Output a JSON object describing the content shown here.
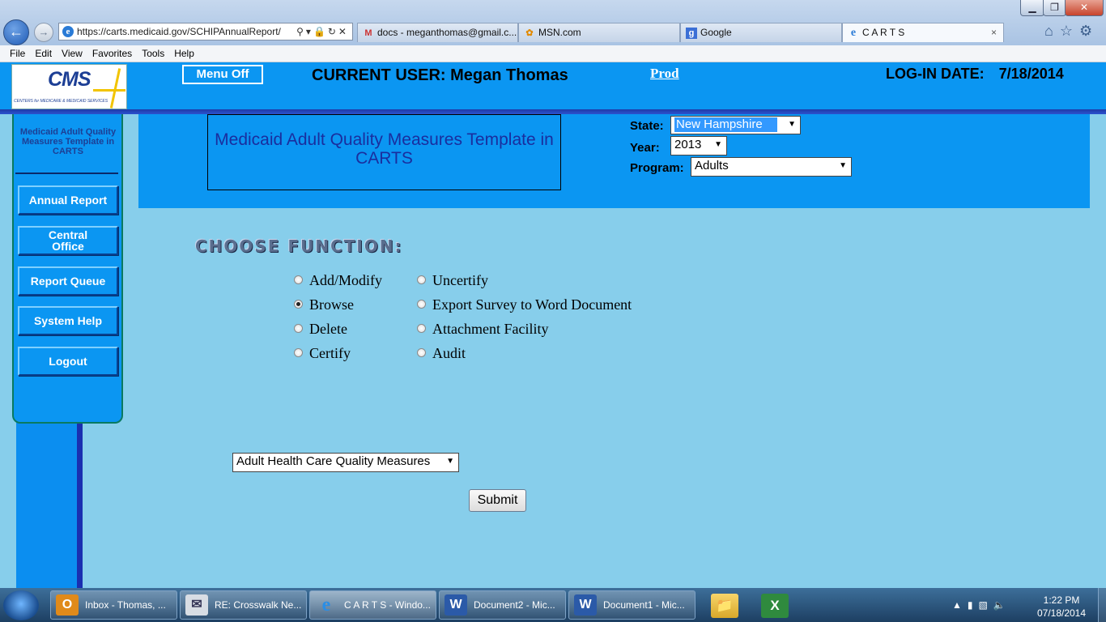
{
  "browser": {
    "url": "https://carts.medicaid.gov/SCHIPAnnualReport/",
    "tabs": [
      {
        "label": "docs - meganthomas@gmail.c..."
      },
      {
        "label": "MSN.com"
      },
      {
        "label": "Google"
      },
      {
        "label": "C A R T S"
      }
    ],
    "tab_close": "×",
    "menu": [
      "File",
      "Edit",
      "View",
      "Favorites",
      "Tools",
      "Help"
    ],
    "window_buttons": {
      "minimize": "▁",
      "maximize": "❐",
      "close": "✕"
    },
    "icons": [
      "home-icon",
      "favorites-star-icon",
      "tools-gear-icon"
    ]
  },
  "header": {
    "logo_text": "CMS",
    "logo_subtext": "CENTERS for MEDICARE & MEDICAID SERVICES",
    "menu_off": "Menu Off",
    "current_user": "CURRENT USER: Megan Thomas",
    "environment": "Prod",
    "login_date_label": "LOG-IN DATE:",
    "login_date": "7/18/2014"
  },
  "left_nav": {
    "title": "Medicaid Adult Quality Measures Template in CARTS",
    "items": [
      {
        "label": "Annual Report"
      },
      {
        "label": "Central Office"
      },
      {
        "label": "Report Queue"
      },
      {
        "label": "System Help"
      },
      {
        "label": "Logout"
      }
    ]
  },
  "main": {
    "title": "Medicaid Adult Quality Measures Template in CARTS",
    "filters": {
      "state_label": "State:",
      "state_value": "New Hampshire",
      "year_label": "Year:",
      "year_value": "2013",
      "program_label": "Program:",
      "program_value": "Adults"
    },
    "choose_function": "CHOOSE FUNCTION:",
    "functions": [
      {
        "label": "Add/Modify",
        "selected": false
      },
      {
        "label": "Browse",
        "selected": true
      },
      {
        "label": "Delete",
        "selected": false
      },
      {
        "label": "Certify",
        "selected": false
      },
      {
        "label": "Uncertify",
        "selected": false
      },
      {
        "label": "Export Survey to Word Document",
        "selected": false
      },
      {
        "label": "Attachment Facility",
        "selected": false
      },
      {
        "label": "Audit",
        "selected": false
      }
    ],
    "measures_select": "Adult Health Care Quality Measures",
    "submit": "Submit"
  },
  "taskbar": {
    "items": [
      {
        "label": "Inbox - Thomas, ...",
        "icon": "outlook-icon"
      },
      {
        "label": "RE: Crosswalk Ne...",
        "icon": "mail-message-icon"
      },
      {
        "label": "C A R T S - Windo...",
        "icon": "internet-explorer-icon"
      },
      {
        "label": "Document2 - Mic...",
        "icon": "word-icon"
      },
      {
        "label": "Document1 - Mic...",
        "icon": "word-icon"
      }
    ],
    "pinned": [
      "file-explorer-icon",
      "excel-icon"
    ],
    "time": "1:22 PM",
    "date": "07/18/2014"
  }
}
